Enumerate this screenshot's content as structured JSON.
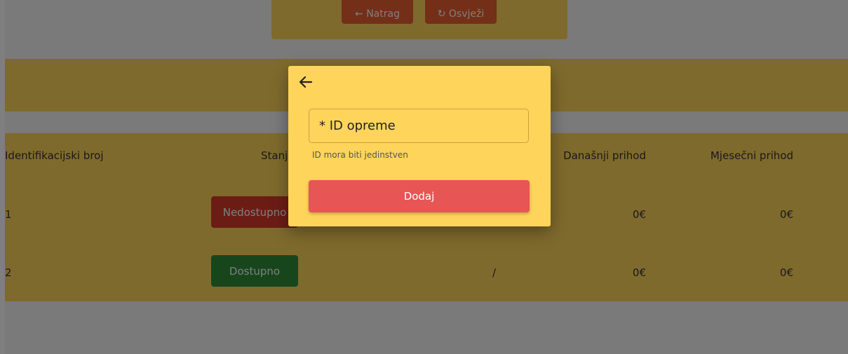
{
  "toolbar": {
    "back_label": "← Natrag",
    "refresh_label": "↻ Osvježi"
  },
  "table": {
    "headers": [
      "Identifikacijski broj",
      "Stanje",
      "Današnji prihod",
      "Mjesečni prihod"
    ],
    "rows": [
      {
        "id": "1",
        "status": "Nedostupno",
        "status_color": "#d73a2b",
        "daily": "0€",
        "monthly": "0€"
      },
      {
        "id": "2",
        "status": "Dostupno",
        "status_color": "#2e8c3b",
        "slash": "/",
        "daily": "0€",
        "monthly": "0€"
      }
    ]
  },
  "dialog": {
    "field_placeholder": "* ID opreme",
    "helper_text": "ID mora biti jedinstven",
    "submit_label": "Dodaj"
  },
  "colors": {
    "panel": "#fed45a",
    "accent_button": "#e85555",
    "toolbar_button": "#e85f33"
  },
  "icons": {
    "back": "arrow-left-icon"
  }
}
